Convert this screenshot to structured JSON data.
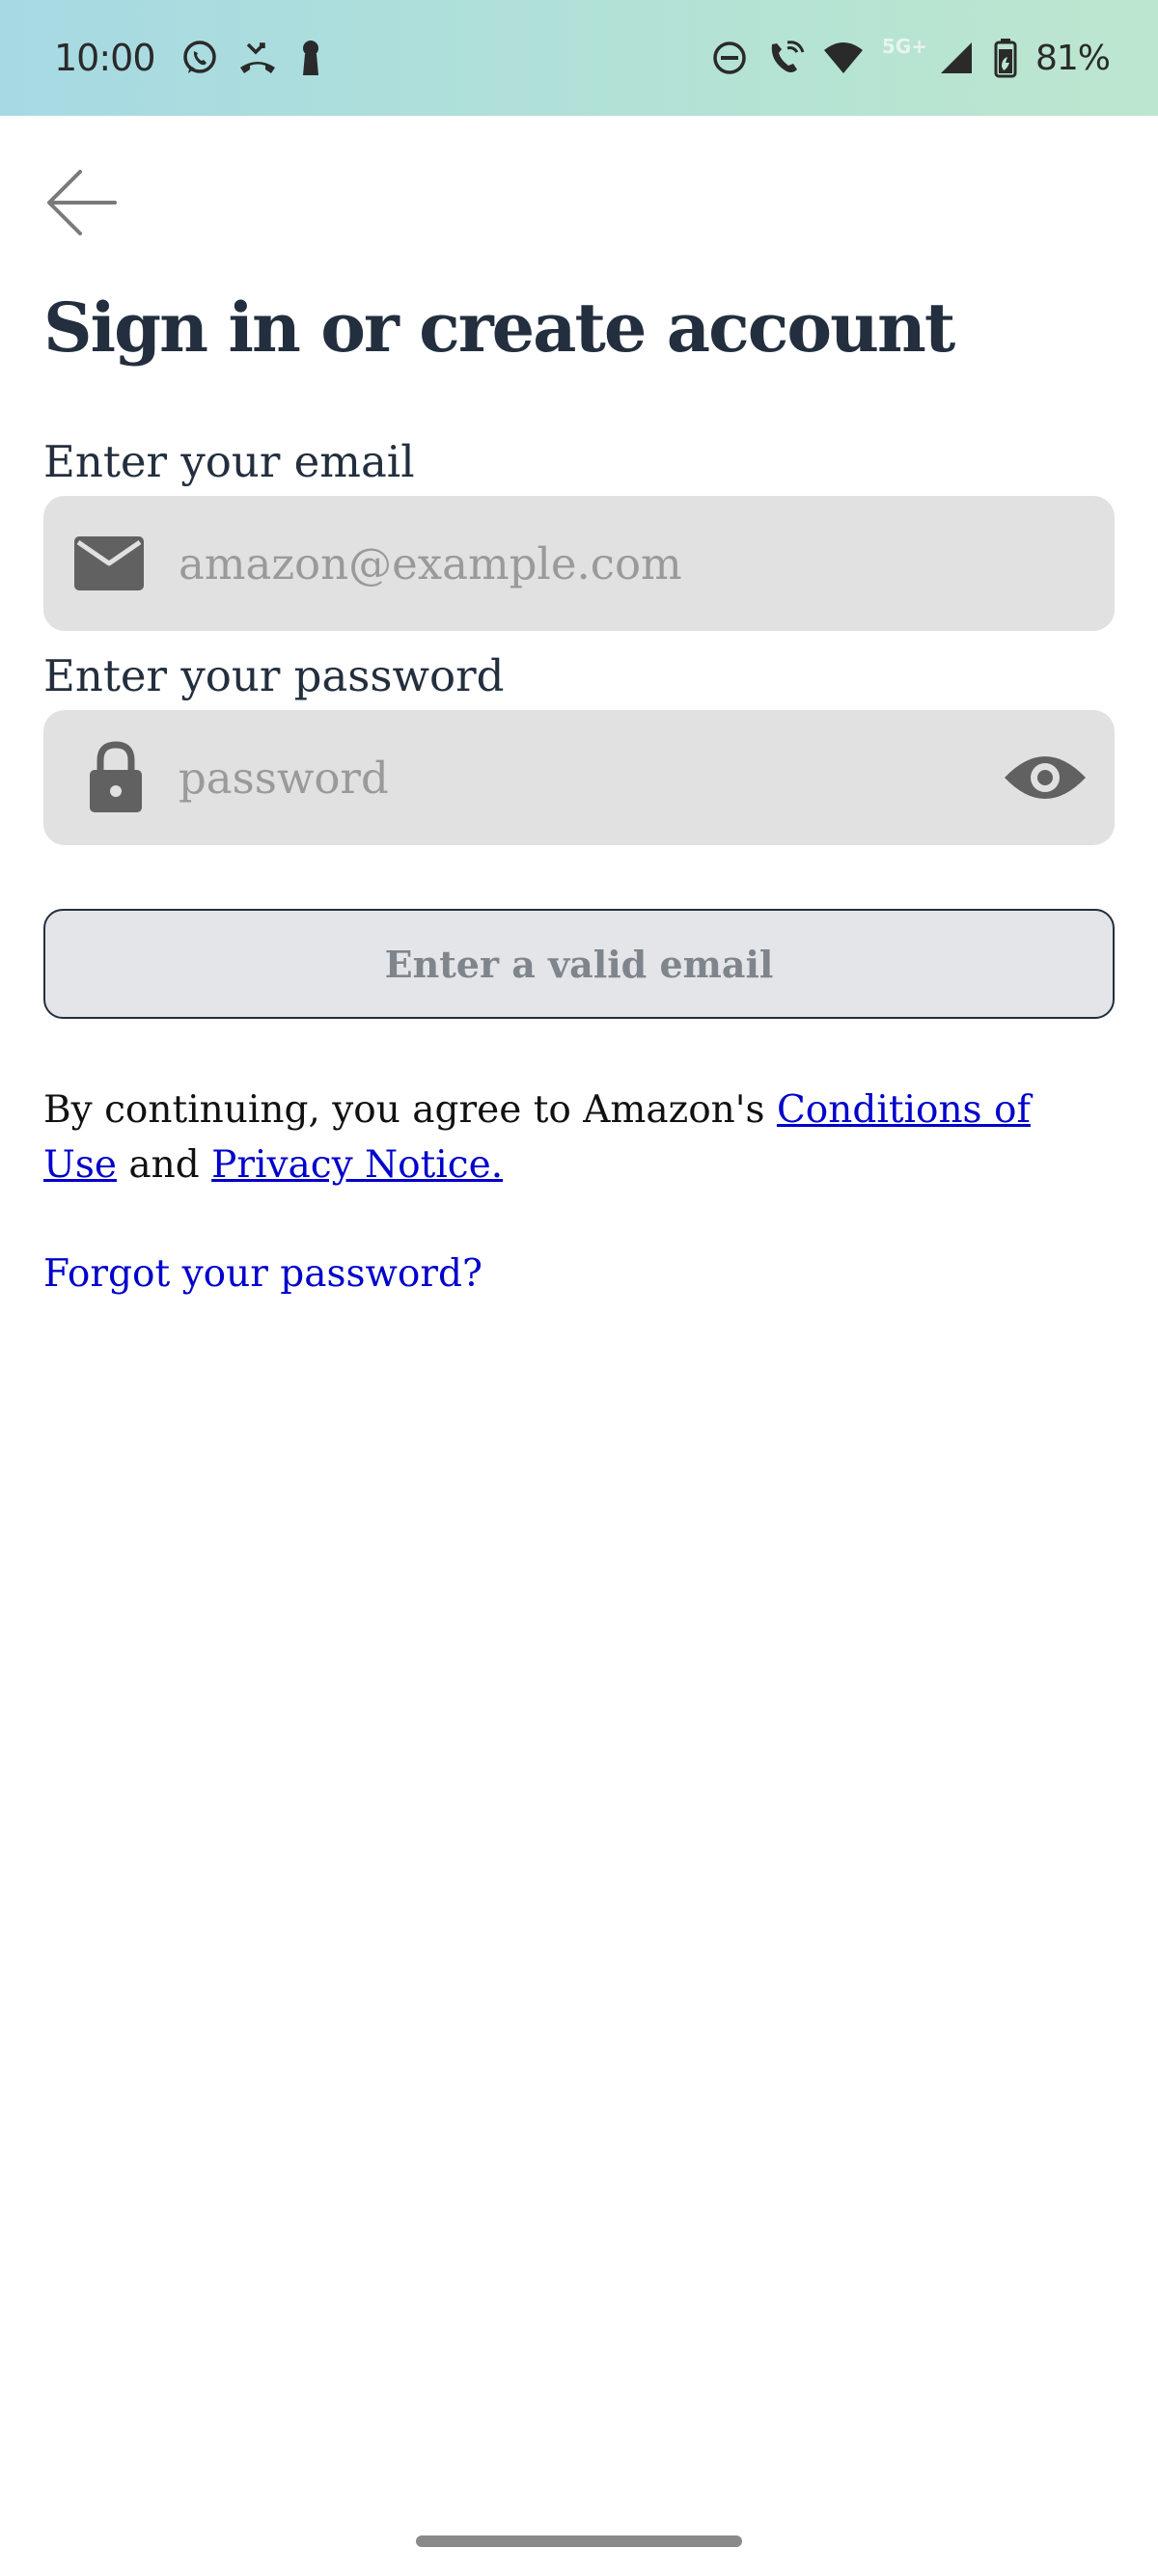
{
  "status_bar": {
    "time": "10:00",
    "network_label": "5G+",
    "battery": "81%",
    "icons_left": [
      "whatsapp-icon",
      "missed-call-icon",
      "keyhole-icon"
    ],
    "icons_right": [
      "do-not-disturb-icon",
      "wifi-calling-icon",
      "wifi-icon",
      "cellular-signal-icon",
      "battery-icon"
    ]
  },
  "header": {
    "back_icon": "arrow-left-icon",
    "title": "Sign in or create account"
  },
  "form": {
    "email": {
      "label": "Enter your email",
      "placeholder": "amazon@example.com",
      "value": "",
      "icon": "mail-icon"
    },
    "password": {
      "label": "Enter your password",
      "placeholder": "password",
      "value": "",
      "icon": "lock-icon",
      "toggle_icon": "eye-icon"
    },
    "submit_label": "Enter a valid email"
  },
  "legal": {
    "prefix": "By continuing, you agree to Amazon's ",
    "conditions_link": "Conditions of Use",
    "middle": " and ",
    "privacy_link": "Privacy Notice."
  },
  "forgot_password": "Forgot your password?",
  "colors": {
    "title": "#232f3e",
    "link": "#0000cc",
    "input_bg": "#e1e1e1",
    "button_bg": "#e3e5e8",
    "button_text": "#7f858d"
  }
}
